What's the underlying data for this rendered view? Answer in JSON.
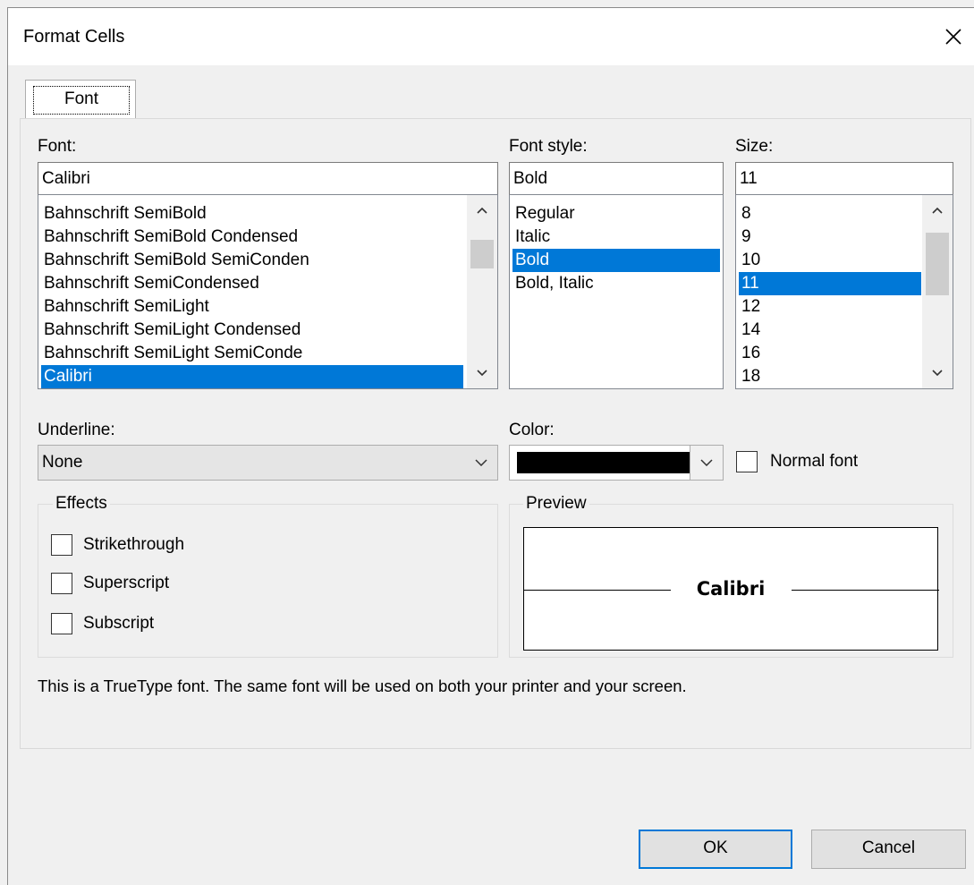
{
  "dialog": {
    "title": "Format Cells"
  },
  "tabs": [
    {
      "label": "Font"
    }
  ],
  "font": {
    "label": "Font:",
    "value": "Calibri",
    "list": [
      "Bahnschrift SemiBold",
      "Bahnschrift SemiBold Condensed",
      "Bahnschrift SemiBold SemiConden",
      "Bahnschrift SemiCondensed",
      "Bahnschrift SemiLight",
      "Bahnschrift SemiLight Condensed",
      "Bahnschrift SemiLight SemiConde",
      "Calibri"
    ],
    "selected": "Calibri"
  },
  "font_style": {
    "label": "Font style:",
    "value": "Bold",
    "list": [
      "Regular",
      "Italic",
      "Bold",
      "Bold, Italic"
    ],
    "selected": "Bold"
  },
  "size": {
    "label": "Size:",
    "value": "11",
    "list": [
      "8",
      "9",
      "10",
      "11",
      "12",
      "14",
      "16",
      "18"
    ],
    "selected": "11"
  },
  "underline": {
    "label": "Underline:",
    "value": "None"
  },
  "color": {
    "label": "Color:",
    "swatch": "#000000"
  },
  "normal_font": {
    "label": "Normal font",
    "checked": false
  },
  "effects": {
    "title": "Effects",
    "options": [
      {
        "label": "Strikethrough",
        "checked": false
      },
      {
        "label": "Superscript",
        "checked": false
      },
      {
        "label": "Subscript",
        "checked": false
      }
    ]
  },
  "preview": {
    "title": "Preview",
    "sample": "Calibri"
  },
  "info_text": "This is a TrueType font. The same font will be used on both your printer and your screen.",
  "buttons": {
    "ok": "OK",
    "cancel": "Cancel"
  },
  "colors": {
    "selection": "#0078d7",
    "default_button_border": "#0078d7"
  }
}
